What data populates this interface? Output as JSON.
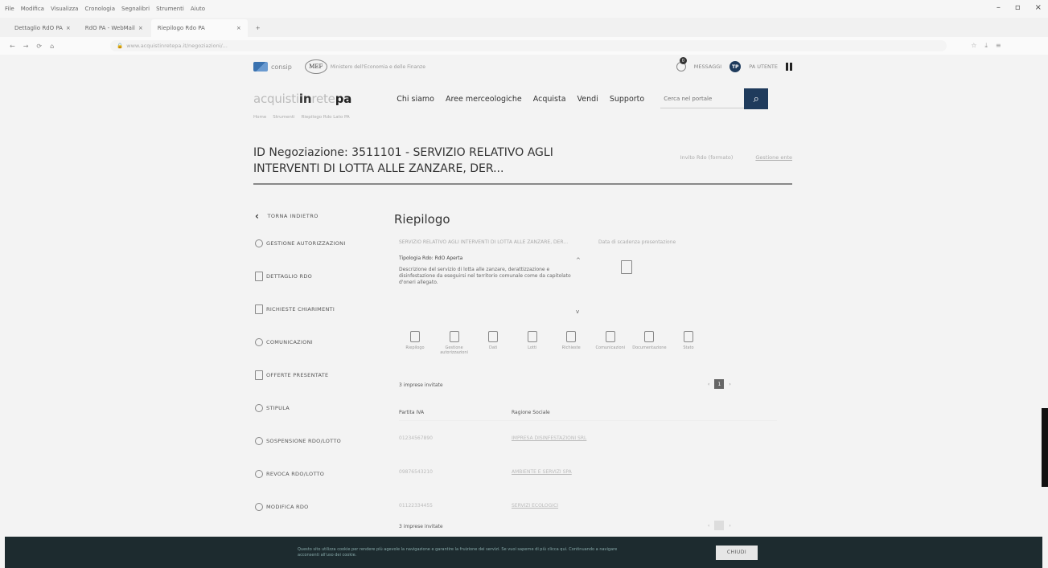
{
  "browser": {
    "menu": [
      "File",
      "Modifica",
      "Visualizza",
      "Cronologia",
      "Segnalibri",
      "Strumenti",
      "Aiuto"
    ],
    "window_controls": [
      "–",
      "▫",
      "×"
    ],
    "tabs": [
      {
        "label": "Dettaglio RdO PA"
      },
      {
        "label": "RdO PA - WebMail"
      },
      {
        "label": "Riepilogo Rdo PA"
      }
    ],
    "tab_close": "×",
    "new_tab": "+",
    "url": "www.acquistinretepa.it/negoziazioni/...",
    "nav_icons": [
      "←",
      "→",
      "⟳",
      "⌂"
    ]
  },
  "header": {
    "consip": "consip",
    "mef": "MEF",
    "mef_sub": "Ministero dell'Economia e delle Finanze",
    "messages_label": "MESSAGGI",
    "messages_count": "0",
    "avatar": "TP",
    "user_label": "PA UTENTE"
  },
  "brand": {
    "part1": "acquisti",
    "part2": "in",
    "part3": "rete",
    "part4": "pa"
  },
  "nav": [
    "Chi siamo",
    "Aree merceologiche",
    "Acquista",
    "Vendi",
    "Supporto"
  ],
  "search": {
    "placeholder": "Cerca nel portale"
  },
  "breadcrumb": [
    "Home",
    "Strumenti",
    "Riepilogo Rdo Lato PA"
  ],
  "page": {
    "title": "ID Negoziazione: 3511101 - SERVIZIO RELATIVO AGLI INTERVENTI DI LOTTA ALLE ZANZARE, DER...",
    "link1": "Invito Rdo (formato)",
    "link2": "Gestione ente"
  },
  "leftnav": {
    "back": "TORNA INDIETRO",
    "items": [
      "GESTIONE AUTORIZZAZIONI",
      "DETTAGLIO RDO",
      "RICHIESTE CHIARIMENTI",
      "COMUNICAZIONI",
      "OFFERTE PRESENTATE",
      "STIPULA",
      "SOSPENSIONE RDO/LOTTO",
      "REVOCA RDO/LOTTO",
      "MODIFICA RDO"
    ]
  },
  "main": {
    "heading": "Riepilogo",
    "summary_line": "SERVIZIO RELATIVO AGLI INTERVENTI DI LOTTA ALLE ZANZARE, DER...",
    "tipologia": "Tipologia Rdo: RdO Aperta",
    "description": "Descrizione del servizio di lotta alle zanzare, derattizzazione e disinfestazione da eseguirsi nel territorio comunale come da capitolato d'oneri allegato.",
    "right_info": "Data di scadenza presentazione",
    "icons": [
      "Riepilogo",
      "Gestione autorizzazioni",
      "Dati",
      "Lotti",
      "Richieste",
      "Comunicazioni",
      "Documentazione",
      "Stato"
    ],
    "invited_count": "3 imprese invitate",
    "col_piva": "Partita IVA",
    "col_ragione": "Ragione Sociale",
    "rows": [
      {
        "piva": "01234567890",
        "ragione": "IMPRESA DISINFESTAZIONI SRL"
      },
      {
        "piva": "09876543210",
        "ragione": "AMBIENTE E SERVIZI SPA"
      },
      {
        "piva": "01122334455",
        "ragione": "SERVIZI ECOLOGICI"
      }
    ],
    "invited_foot": "3 imprese invitate",
    "pager_current": "1"
  },
  "cookie": {
    "text": "Questo sito utilizza cookie per rendere più agevole la navigazione e garantire la fruizione dei servizi. Se vuoi saperne di più clicca qui. Continuando a navigare acconsenti all'uso dei cookie.",
    "button": "CHIUDI"
  }
}
